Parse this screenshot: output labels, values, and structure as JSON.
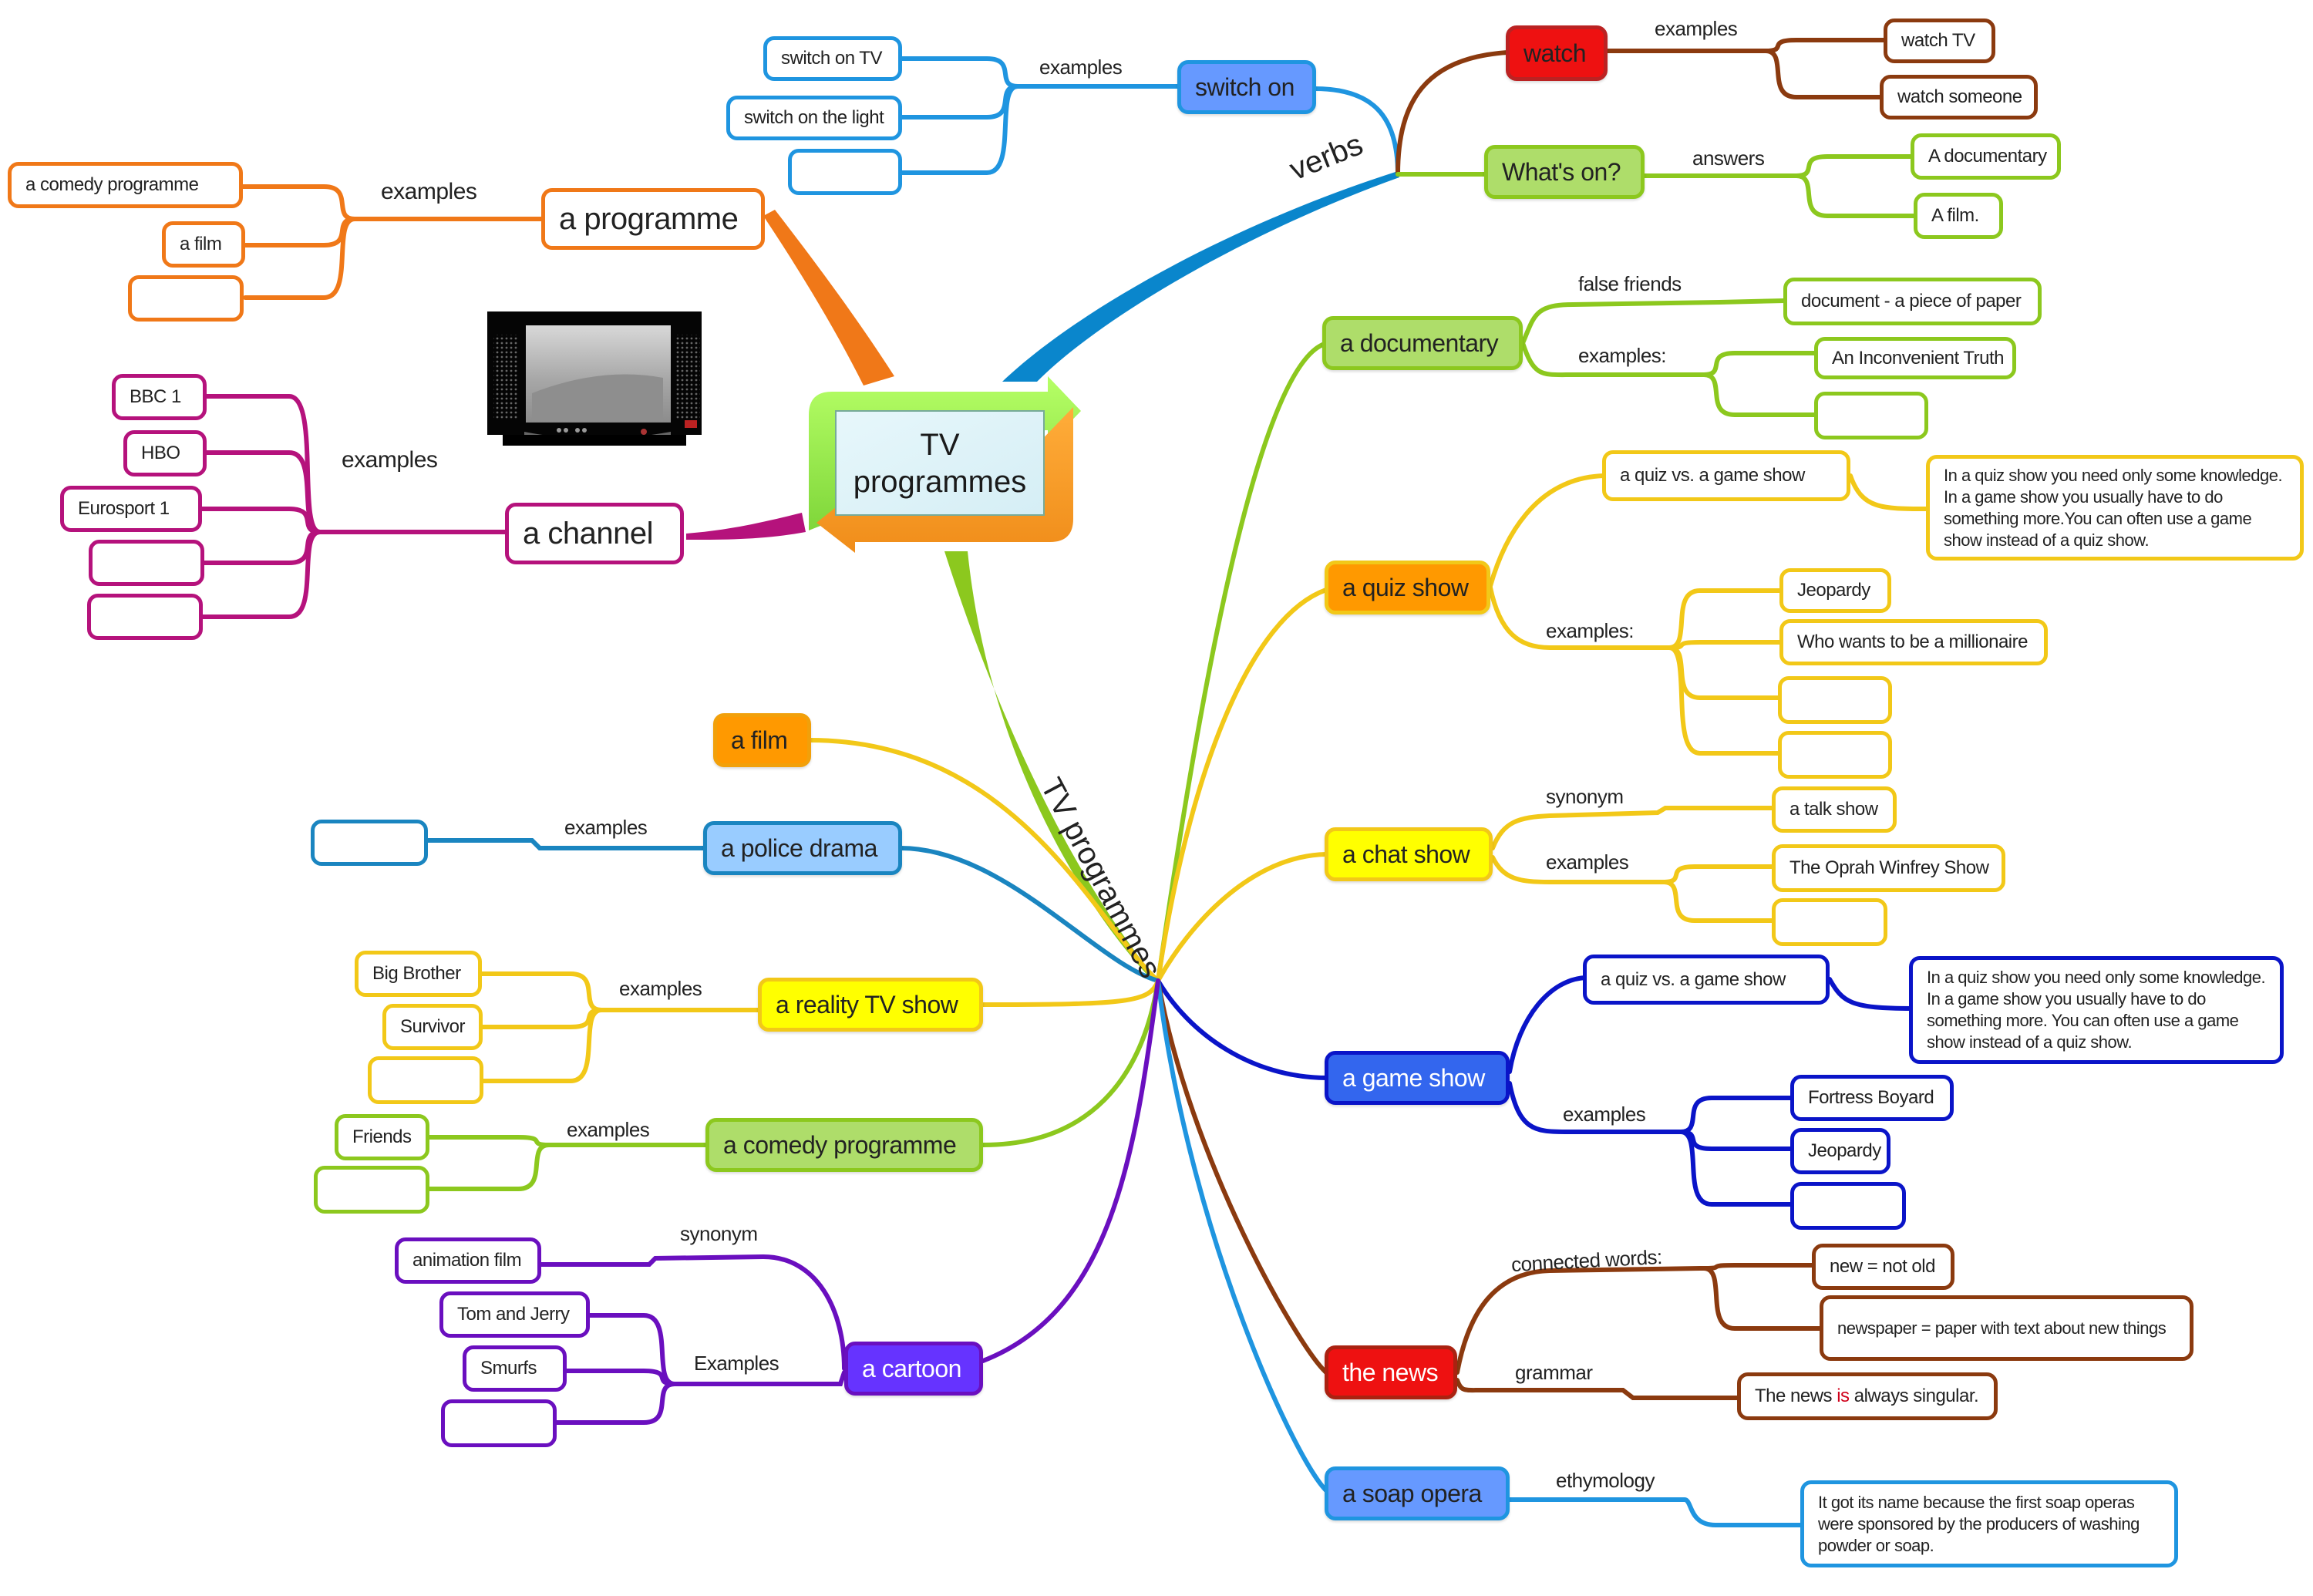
{
  "center": {
    "line1": "TV",
    "line2": "programmes"
  },
  "branch_labels": {
    "verbs": "verbs",
    "tv_programmes": "TV programmes"
  },
  "colors": {
    "orange": "#f07818",
    "blue": "#1f95e0",
    "darkblue_branch": "#0a86cc",
    "magenta": "#b5127c",
    "brown": "#8b3a0f",
    "red": "#ee1111",
    "lime": "#8cc81e",
    "lime_fill": "#aedd6a",
    "yellow": "#f2c818",
    "yellow_fill": "#ffff00",
    "amber_fill": "#ff9900",
    "royal": "#0a14c8",
    "royal_fill": "#3366ee",
    "purple": "#6a0fbf",
    "purple_fill": "#6633ff",
    "sky_fill": "#99ccff",
    "police_blue": "#1a85c0",
    "soap_fill": "#6699ff",
    "switch_fill": "#6699ff"
  },
  "nodes": {
    "programme": {
      "label": "a programme",
      "rel": "examples",
      "children": [
        "a comedy programme",
        "a film",
        ""
      ]
    },
    "channel": {
      "label": "a channel",
      "rel": "examples",
      "children": [
        "BBC 1",
        "HBO",
        "Eurosport 1",
        "",
        ""
      ]
    },
    "switch_on": {
      "label": "switch on",
      "rel": "examples",
      "children": [
        "switch on TV",
        "switch on the light",
        ""
      ]
    },
    "watch": {
      "label": "watch",
      "rel": "examples",
      "children": [
        "watch TV",
        "watch someone"
      ]
    },
    "whats_on": {
      "label": "What's on?",
      "rel": "answers",
      "children": [
        "A documentary",
        "A film."
      ]
    },
    "documentary": {
      "label": "a documentary",
      "rel1": "false friends",
      "child1": "document - a piece of paper",
      "rel2": "examples:",
      "children2": [
        "An Inconvenient Truth",
        ""
      ]
    },
    "quiz_show": {
      "label": "a quiz show",
      "compare": "a quiz vs. a game show",
      "note": "In a quiz show you need only some knowledge. In a game show you usually have to do something more.You can often use a game show instead of a quiz show.",
      "rel2": "examples:",
      "children2": [
        "Jeopardy",
        "Who wants to be a millionaire",
        "",
        ""
      ]
    },
    "chat_show": {
      "label": "a chat show",
      "rel1": "synonym",
      "child1": "a talk show",
      "rel2": "examples",
      "children2": [
        "The Oprah Winfrey Show",
        ""
      ]
    },
    "game_show": {
      "label": "a game show",
      "compare": "a quiz vs. a game show",
      "note": "In a quiz show you need only some knowledge. In a game show you usually have to do something more. You can often use a game show instead of a quiz show.",
      "rel2": "examples",
      "children2": [
        "Fortress Boyard",
        "Jeopardy",
        ""
      ]
    },
    "news": {
      "label": "the news",
      "rel1": "connected words:",
      "children1": [
        "new = not old",
        "newspaper = paper with text about new things"
      ],
      "rel2": "grammar",
      "grammar_pre": "The news ",
      "grammar_hl": "is",
      "grammar_post": " always singular."
    },
    "soap": {
      "label": "a soap opera",
      "rel": "ethymology",
      "note": "It got its name because the first soap operas were sponsored by the producers of washing powder or soap."
    },
    "film": {
      "label": "a film"
    },
    "police": {
      "label": "a police drama",
      "rel": "examples",
      "children": [
        ""
      ]
    },
    "reality": {
      "label": "a reality TV show",
      "rel": "examples",
      "children": [
        "Big Brother",
        "Survivor",
        ""
      ]
    },
    "comedy": {
      "label": "a comedy programme",
      "rel": "examples",
      "children": [
        "Friends",
        ""
      ]
    },
    "cartoon": {
      "label": "a cartoon",
      "rel1": "synonym",
      "child1": "animation film",
      "rel2": "Examples",
      "children2": [
        "Tom and Jerry",
        "Smurfs",
        ""
      ]
    }
  }
}
